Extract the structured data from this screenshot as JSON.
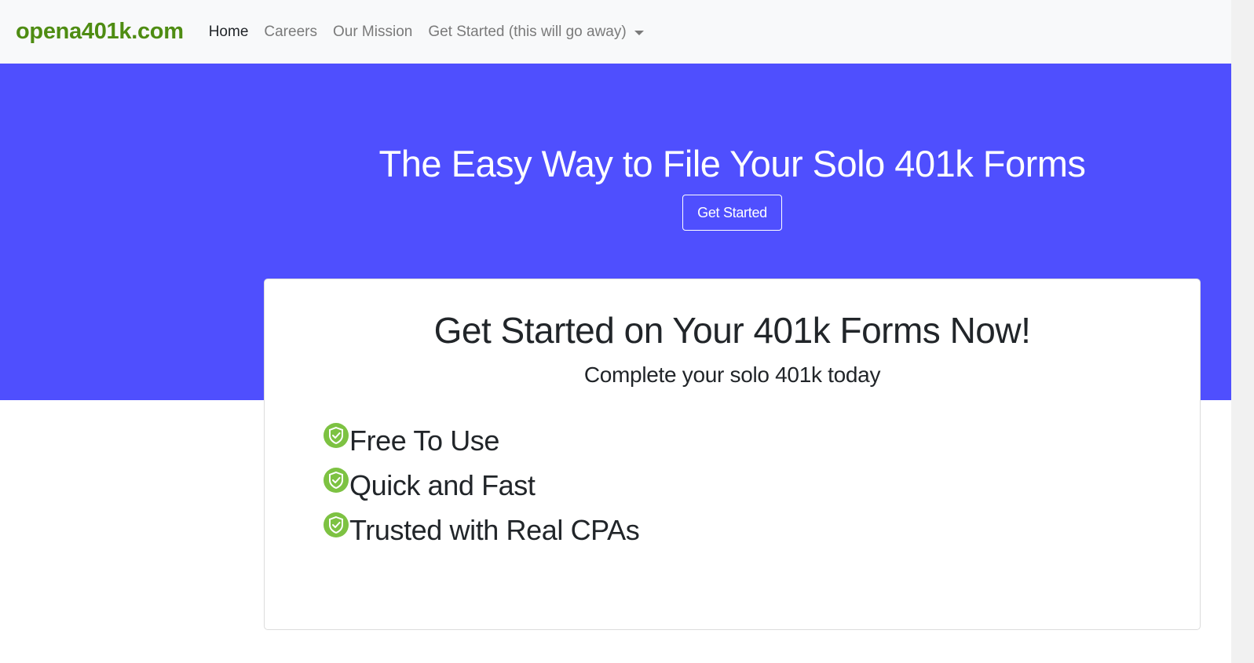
{
  "navbar": {
    "brand": "opena401k.com",
    "links": [
      {
        "label": "Home",
        "active": true
      },
      {
        "label": "Careers",
        "active": false
      },
      {
        "label": "Our Mission",
        "active": false
      }
    ],
    "dropdown_label": "Get Started (this will go away)"
  },
  "hero": {
    "title": "The Easy Way to File Your Solo 401k Forms",
    "button_label": "Get Started",
    "background_color": "#4f4ffe"
  },
  "card": {
    "title": "Get Started on Your 401k Forms Now!",
    "subtitle": "Complete your solo 401k today",
    "features": [
      {
        "icon": "shield-check-icon",
        "label": "Free To Use"
      },
      {
        "icon": "shield-check-icon",
        "label": "Quick and Fast"
      },
      {
        "icon": "shield-check-icon",
        "label": "Trusted with Real CPAs"
      }
    ]
  },
  "colors": {
    "brand": "#4e8c12",
    "feature_icon": "#7dc242"
  }
}
